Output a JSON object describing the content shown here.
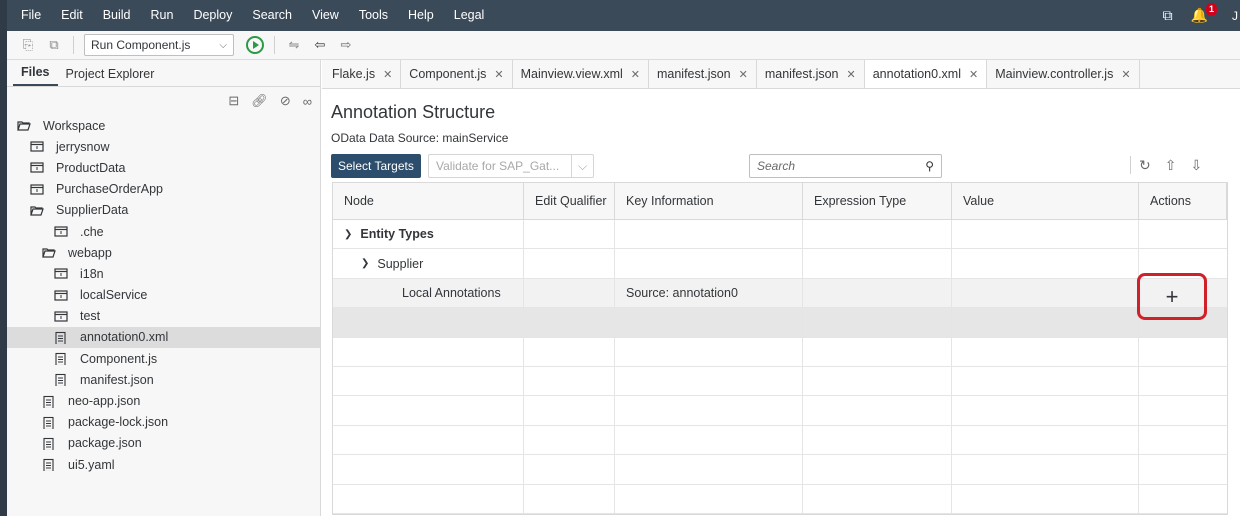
{
  "menubar": {
    "items": [
      "File",
      "Edit",
      "Build",
      "Run",
      "Deploy",
      "Search",
      "View",
      "Tools",
      "Help",
      "Legal"
    ],
    "notification_count": "1",
    "user_initial": "J"
  },
  "toolbar": {
    "run_config": "Run Component.js"
  },
  "left_pane": {
    "tabs": [
      "Files",
      "Project Explorer"
    ],
    "tree": [
      {
        "label": "Workspace",
        "icon": "folder-open-icon"
      },
      {
        "label": "jerrysnow",
        "icon": "project-folder-icon"
      },
      {
        "label": "ProductData",
        "icon": "project-folder-icon"
      },
      {
        "label": "PurchaseOrderApp",
        "icon": "project-folder-icon"
      },
      {
        "label": "SupplierData",
        "icon": "folder-open-icon"
      },
      {
        "label": ".che",
        "icon": "folder-icon"
      },
      {
        "label": "webapp",
        "icon": "folder-open-icon"
      },
      {
        "label": "i18n",
        "icon": "folder-icon"
      },
      {
        "label": "localService",
        "icon": "folder-icon"
      },
      {
        "label": "test",
        "icon": "folder-icon"
      },
      {
        "label": "annotation0.xml",
        "icon": "file-icon",
        "selected": true
      },
      {
        "label": "Component.js",
        "icon": "file-icon"
      },
      {
        "label": "manifest.json",
        "icon": "file-icon"
      },
      {
        "label": "neo-app.json",
        "icon": "file-icon"
      },
      {
        "label": "package-lock.json",
        "icon": "file-icon"
      },
      {
        "label": "package.json",
        "icon": "file-icon"
      },
      {
        "label": "ui5.yaml",
        "icon": "file-icon"
      }
    ]
  },
  "editor_tabs": [
    "Flake.js",
    "Component.js",
    "Mainview.view.xml",
    "manifest.json",
    "manifest.json",
    "annotation0.xml",
    "Mainview.controller.js"
  ],
  "annotation": {
    "title": "Annotation Structure",
    "subtitle": "OData Data Source: mainService",
    "select_targets": "Select Targets",
    "validate": "Validate for SAP_Gat...",
    "search_placeholder": "Search"
  },
  "table": {
    "headers": [
      "Node",
      "Edit Qualifier",
      "Key Information",
      "Expression Type",
      "Value",
      "Actions"
    ],
    "rows": [
      {
        "node": "Entity Types",
        "key_info": ""
      },
      {
        "node": "Supplier",
        "key_info": ""
      },
      {
        "node": "Local Annotations",
        "key_info": "Source: annotation0"
      }
    ],
    "add_action": "+"
  },
  "colors": {
    "menubar": "#3b4a59",
    "primary_button": "#2c4e6c",
    "highlight_box": "#d0202a",
    "run_green": "#2b9a46"
  }
}
